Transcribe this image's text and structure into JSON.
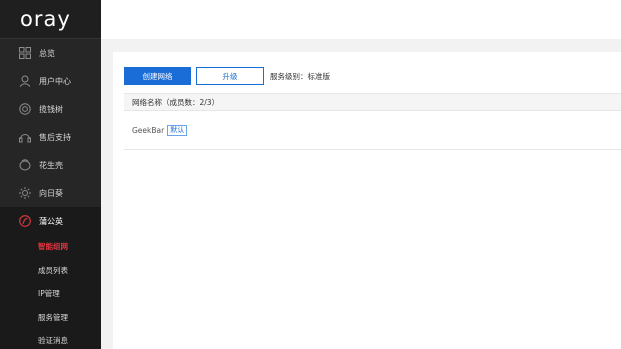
{
  "brand": {
    "logo": "oray"
  },
  "sidebar": {
    "items": [
      {
        "label": "总览",
        "icon": "grid-icon"
      },
      {
        "label": "用户中心",
        "icon": "user-icon"
      },
      {
        "label": "揽钱树",
        "icon": "target-icon"
      },
      {
        "label": "售后支持",
        "icon": "headset-icon"
      },
      {
        "label": "花生壳",
        "icon": "peanut-icon"
      },
      {
        "label": "向日葵",
        "icon": "sunflower-icon"
      },
      {
        "label": "蒲公英",
        "icon": "dandelion-icon"
      }
    ],
    "submenu": [
      {
        "label": "智能组网"
      },
      {
        "label": "成员列表"
      },
      {
        "label": "IP管理"
      },
      {
        "label": "服务管理"
      },
      {
        "label": "验证消息"
      }
    ]
  },
  "toolbar": {
    "create_label": "创建网络",
    "upgrade_label": "升级",
    "service_level": "服务级别：标准版"
  },
  "table": {
    "header": "网络名称（成员数：2/3）",
    "rows": [
      {
        "name": "GeekBar",
        "badge": "默认"
      }
    ]
  },
  "colors": {
    "accent": "#1a6cd6",
    "active": "#e1353e",
    "sidebar_bg": "#262626"
  }
}
